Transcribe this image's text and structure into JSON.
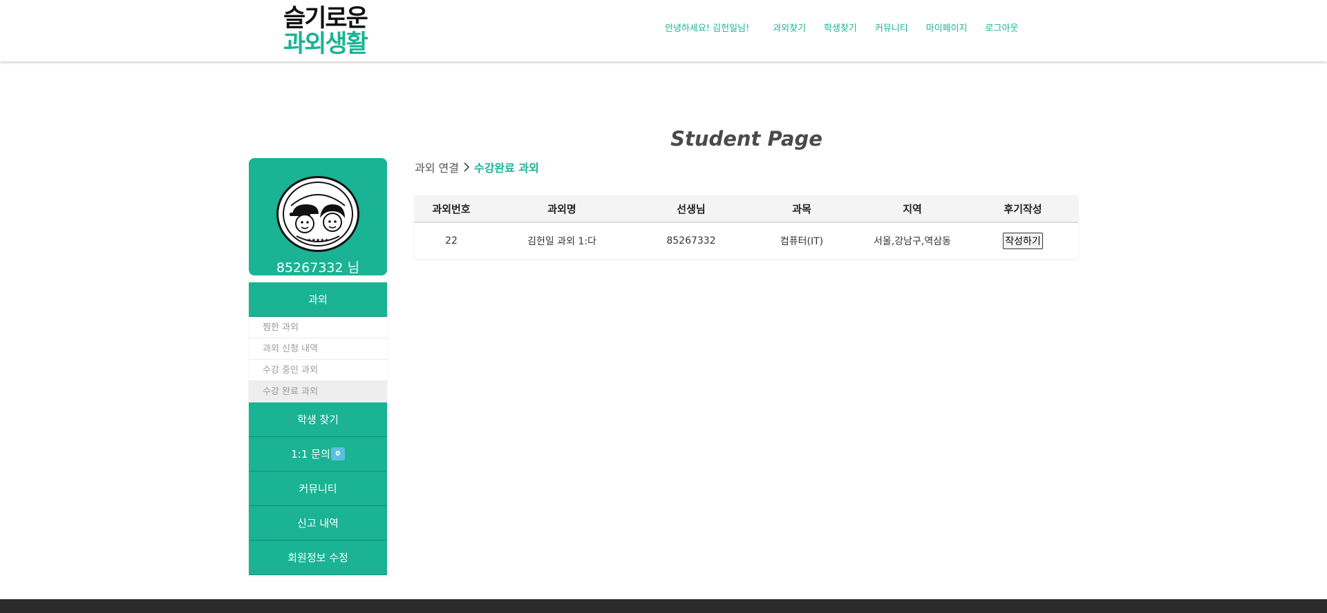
{
  "header": {
    "logo_line1": "슬기로운",
    "logo_line2": "과외생활",
    "greeting": "안녕하세요! 김헌일님!",
    "nav": [
      "과외찾기",
      "학생찾기",
      "커뮤니티",
      "마이페이지",
      "로그아웃"
    ]
  },
  "page": {
    "title": "Student Page"
  },
  "profile": {
    "name": "85267332 님"
  },
  "sidebar": {
    "section_tutoring": "과외",
    "submenu": [
      "찜한 과외",
      "과외 신청 내역",
      "수강 중인 과외",
      "수강 완료 과외"
    ],
    "active_submenu": "수강 완료 과외",
    "find_students": "학생 찾기",
    "inquiry": "1:1 문의",
    "inquiry_badge": "0",
    "community": "커뮤니티",
    "reports": "신고 내역",
    "edit_profile": "회원정보 수정"
  },
  "breadcrumb": {
    "parent": "과외 연결",
    "current": "수강완료 과외"
  },
  "table": {
    "headers": [
      "과외번호",
      "과외명",
      "선생님",
      "과목",
      "지역",
      "후기작성"
    ],
    "rows": [
      {
        "id": "22",
        "name": "김헌일 과외 1:다",
        "teacher": "85267332",
        "subject": "컴퓨터(IT)",
        "region": "서울,강남구,역삼동",
        "action": "작성하기"
      }
    ]
  },
  "colors": {
    "accent": "#1ab394",
    "footer": "#2b2b2b",
    "badge": "#5bc0de"
  }
}
